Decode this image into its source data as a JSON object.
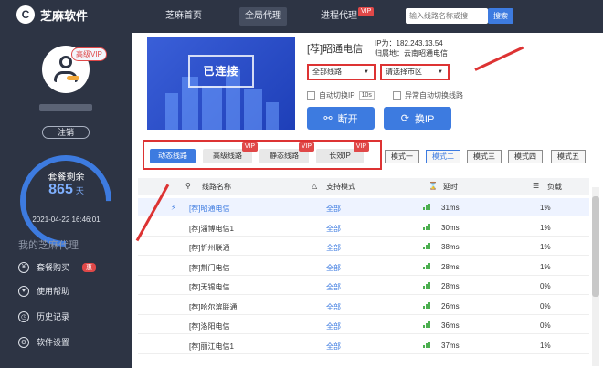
{
  "app": {
    "logo_char": "C",
    "name": "芝麻软件"
  },
  "sidebar": {
    "vip_badge": "高级VIP",
    "logout": "注销",
    "remaining_label": "套餐剩余",
    "remaining_value": "865",
    "remaining_unit": "天",
    "expire_time": "2021-04-22 16:46:01",
    "section_title": "我的芝麻代理",
    "menu": [
      {
        "label": "套餐购买",
        "badge": "惠",
        "icon": "yen-icon"
      },
      {
        "label": "使用帮助",
        "icon": "heart-icon"
      },
      {
        "label": "历史记录",
        "icon": "clock-icon"
      },
      {
        "label": "软件设置",
        "icon": "gear-icon"
      }
    ]
  },
  "topbar": {
    "tabs": [
      {
        "label": "芝麻首页"
      },
      {
        "label": "全局代理"
      },
      {
        "label": "进程代理",
        "vip": "VIP"
      }
    ],
    "search_placeholder": "输入线路名称或搜",
    "search_button": "搜索"
  },
  "main": {
    "status": "已连接",
    "node_name": "[荐]昭通电信",
    "ip_line": "IP为：182.243.13.54",
    "location_line": "归属地：云南昭通电信",
    "line_select": "全部线路",
    "city_select": "请选择市区",
    "auto_switch_label": "自动切换IP",
    "auto_switch_seconds": "10s",
    "abnormal_switch_label": "异常自动切换线路",
    "disconnect_label": "断开",
    "change_ip_label": "换IP",
    "line_tabs": [
      {
        "label": "动态线路",
        "vip": ""
      },
      {
        "label": "高级线路",
        "vip": "VIP"
      },
      {
        "label": "静态线路",
        "vip": "VIP"
      },
      {
        "label": "长效IP",
        "vip": "VIP"
      }
    ],
    "modes": [
      "模式一",
      "模式二",
      "模式三",
      "模式四",
      "模式五"
    ],
    "table_headers": {
      "name": "线路名称",
      "support": "支持模式",
      "delay": "延时",
      "load": "负载"
    },
    "rows": [
      {
        "name": "[荐]昭通电信",
        "mode": "全部",
        "delay": "31ms",
        "load": "1%"
      },
      {
        "name": "[荐]淄博电信1",
        "mode": "全部",
        "delay": "30ms",
        "load": "1%"
      },
      {
        "name": "[荐]忻州联通",
        "mode": "全部",
        "delay": "38ms",
        "load": "1%"
      },
      {
        "name": "[荐]荆门电信",
        "mode": "全部",
        "delay": "28ms",
        "load": "1%"
      },
      {
        "name": "[荐]无锡电信",
        "mode": "全部",
        "delay": "28ms",
        "load": "0%"
      },
      {
        "name": "[荐]哈尔滨联通",
        "mode": "全部",
        "delay": "26ms",
        "load": "0%"
      },
      {
        "name": "[荐]洛阳电信",
        "mode": "全部",
        "delay": "36ms",
        "load": "0%"
      },
      {
        "name": "[荐]丽江电信1",
        "mode": "全部",
        "delay": "37ms",
        "load": "1%"
      }
    ]
  },
  "colors": {
    "sidebar_bg": "#2d3444",
    "accent": "#3d7be0",
    "highlight": "#d33333"
  }
}
